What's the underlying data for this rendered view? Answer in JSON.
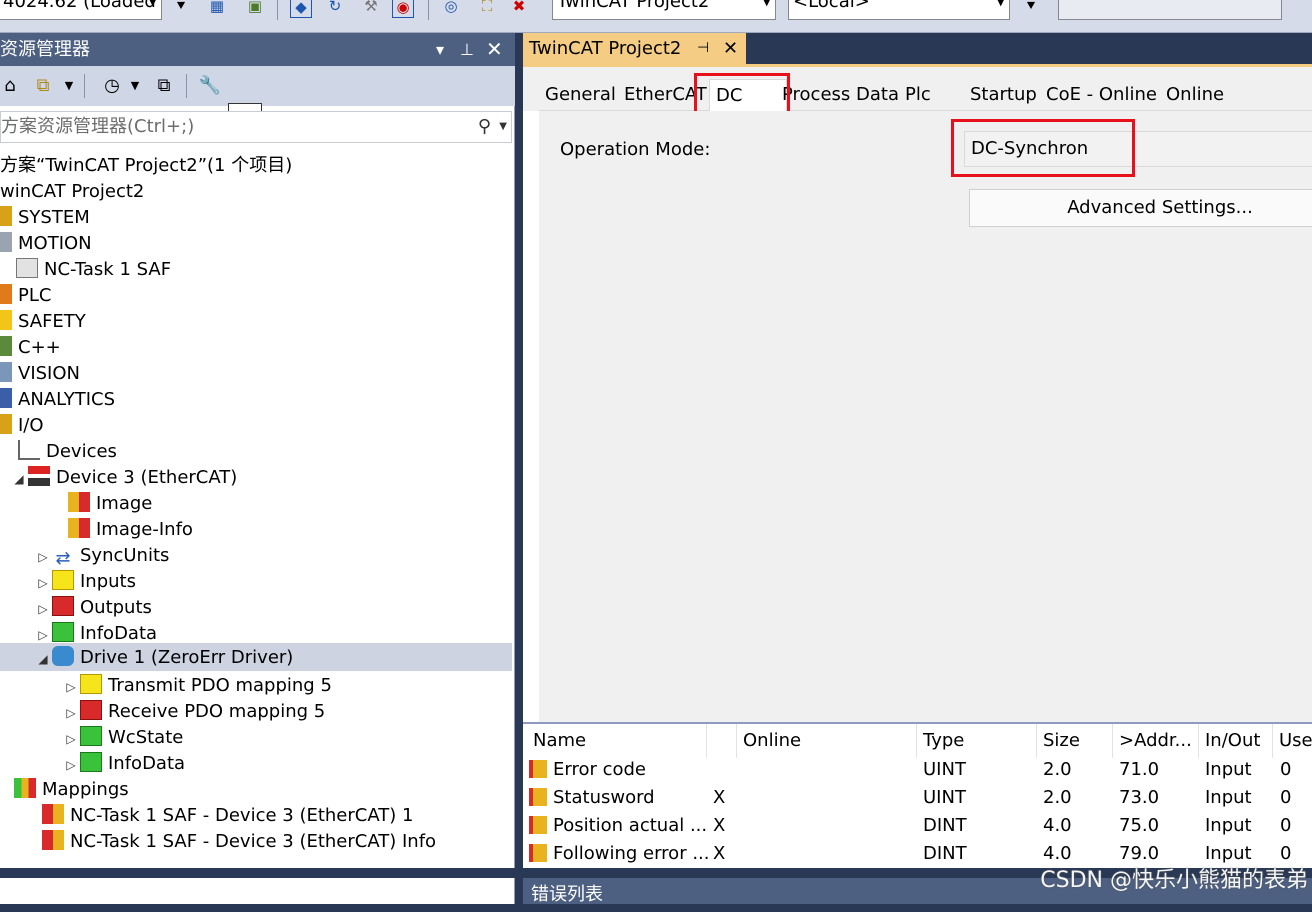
{
  "toolbar": {
    "version_combo": "4024.62 (Loaded",
    "project_combo": "TwinCAT Project2",
    "target_combo": "<Local>"
  },
  "solution_explorer": {
    "title": "资源管理器",
    "search_placeholder": "方案资源管理器(Ctrl+;)",
    "tree": [
      {
        "label": "方案“TwinCAT Project2”(1 个项目)"
      },
      {
        "label": "winCAT Project2"
      },
      {
        "label": "SYSTEM"
      },
      {
        "label": "MOTION"
      },
      {
        "label": "NC-Task 1 SAF"
      },
      {
        "label": "PLC"
      },
      {
        "label": "SAFETY"
      },
      {
        "label": "C++"
      },
      {
        "label": "VISION"
      },
      {
        "label": "ANALYTICS"
      },
      {
        "label": "I/O"
      },
      {
        "label": "Devices"
      },
      {
        "label": "Device 3 (EtherCAT)"
      },
      {
        "label": "Image"
      },
      {
        "label": "Image-Info"
      },
      {
        "label": "SyncUnits"
      },
      {
        "label": "Inputs"
      },
      {
        "label": "Outputs"
      },
      {
        "label": "InfoData"
      },
      {
        "label": "Drive 1 (ZeroErr Driver)"
      },
      {
        "label": "Transmit PDO mapping 5"
      },
      {
        "label": "Receive PDO mapping 5"
      },
      {
        "label": "WcState"
      },
      {
        "label": "InfoData"
      },
      {
        "label": "Mappings"
      },
      {
        "label": "NC-Task 1 SAF - Device 3 (EtherCAT) 1"
      },
      {
        "label": "NC-Task 1 SAF - Device 3 (EtherCAT) Info"
      }
    ]
  },
  "document": {
    "tab_title": "TwinCAT Project2",
    "tabs": [
      "General",
      "EtherCAT",
      "DC",
      "Process Data",
      "Plc",
      "Startup",
      "CoE - Online",
      "Online"
    ],
    "active_tab": "DC",
    "operation_mode_label": "Operation Mode:",
    "operation_mode_value": "DC-Synchron",
    "advanced_button": "Advanced Settings..."
  },
  "grid": {
    "columns": [
      "Name",
      "",
      "Online",
      "Type",
      "Size",
      ">Addr...",
      "In/Out",
      "Use"
    ],
    "rows": [
      {
        "name": "Error code",
        "x": "",
        "type": "UINT",
        "size": "2.0",
        "addr": "71.0",
        "inout": "Input",
        "use": "0"
      },
      {
        "name": "Statusword",
        "x": "X",
        "type": "UINT",
        "size": "2.0",
        "addr": "73.0",
        "inout": "Input",
        "use": "0"
      },
      {
        "name": "Position actual ...",
        "x": "X",
        "type": "DINT",
        "size": "4.0",
        "addr": "75.0",
        "inout": "Input",
        "use": "0"
      },
      {
        "name": "Following error ...",
        "x": "X",
        "type": "DINT",
        "size": "4.0",
        "addr": "79.0",
        "inout": "Input",
        "use": "0"
      }
    ]
  },
  "bottom": {
    "error_list_tab": "错误列表",
    "watermark": "CSDN @快乐小熊猫的表弟"
  }
}
